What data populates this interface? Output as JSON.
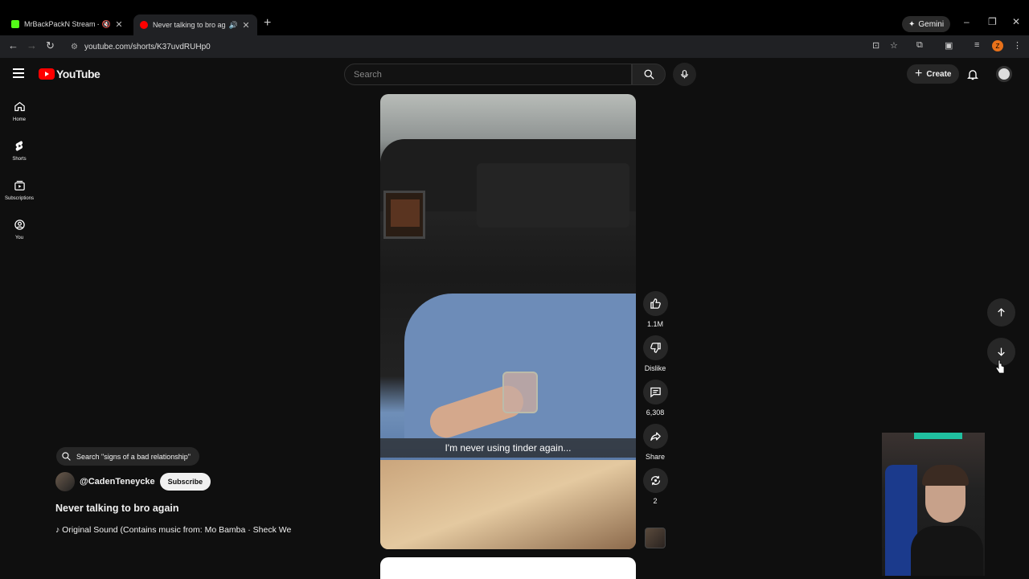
{
  "browser": {
    "tabs": [
      {
        "title": "MrBackPackN Stream - Wa...",
        "favicon_color": "#53fc18"
      },
      {
        "title": "Never talking to bro again",
        "favicon_color": "#ff0000"
      }
    ],
    "gemini_label": "Gemini",
    "url": "youtube.com/shorts/K37uvdRUHp0",
    "profile_initial": "Z"
  },
  "youtube": {
    "logo_text": "YouTube",
    "search_placeholder": "Search",
    "create_label": "Create",
    "sidebar": [
      {
        "label": "Home",
        "icon": "home-icon"
      },
      {
        "label": "Shorts",
        "icon": "shorts-icon"
      },
      {
        "label": "Subscriptions",
        "icon": "subscriptions-icon"
      },
      {
        "label": "You",
        "icon": "you-icon"
      }
    ]
  },
  "short": {
    "caption": "I'm never using tinder again...",
    "actions": {
      "like_count": "1.1M",
      "dislike_label": "Dislike",
      "comment_count": "6,308",
      "share_label": "Share",
      "remix_count": "2"
    },
    "related_search": "Search \"signs of a bad relationship\"",
    "channel_handle": "@CadenTeneycke",
    "subscribe_label": "Subscribe",
    "title": "Never talking to bro again",
    "sound": "Original Sound (Contains music from: Mo Bamba · Sheck We"
  }
}
